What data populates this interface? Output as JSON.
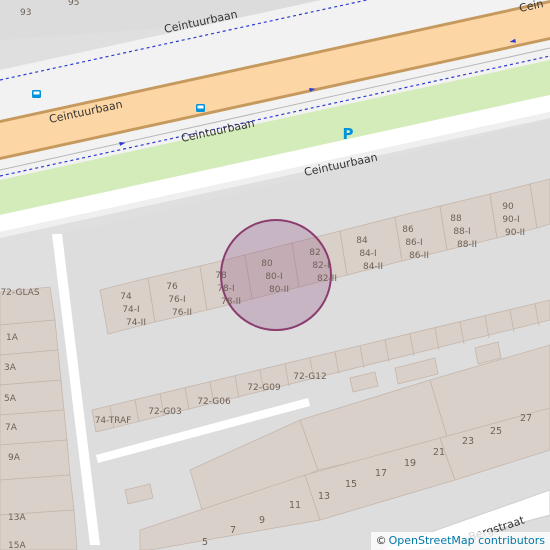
{
  "map": {
    "roads": {
      "main": "Ceintuurbaan",
      "main_top_fragment": "Cein",
      "service_road": "Ceintuurbaan",
      "parallel_road": "Ceintuurbaan",
      "side_street": "...is van der Bergstraat",
      "side_street_visible": "Bergstraat"
    },
    "parking_symbol": "P",
    "house_numbers": {
      "top": [
        "93",
        "95"
      ],
      "main_row": [
        {
          "lines": [
            "74",
            "74-I",
            "74-II"
          ]
        },
        {
          "lines": [
            "76",
            "76-I",
            "76-II"
          ]
        },
        {
          "lines": [
            "78",
            "78-I",
            "78-II"
          ]
        },
        {
          "lines": [
            "80",
            "80-I",
            "80-II"
          ]
        },
        {
          "lines": [
            "82",
            "82-I",
            "82-II"
          ]
        },
        {
          "lines": [
            "84",
            "84-I",
            "84-II"
          ]
        },
        {
          "lines": [
            "86",
            "86-I",
            "86-II"
          ]
        },
        {
          "lines": [
            "88",
            "88-I",
            "88-II"
          ]
        },
        {
          "lines": [
            "90",
            "90-I",
            "90-II"
          ]
        }
      ],
      "garages": [
        "74-TRAF",
        "72-G03",
        "72-G06",
        "72-G09",
        "72-G12"
      ],
      "left_column": [
        "72-GLAS",
        "1A",
        "3A",
        "5A",
        "7A",
        "9A",
        "13A",
        "15A"
      ],
      "bottom_row": [
        "5",
        "7",
        "9",
        "11",
        "13",
        "15",
        "17",
        "19",
        "21",
        "23",
        "25",
        "27"
      ]
    },
    "colors": {
      "background": "#e0dfdf",
      "primary_road": "#fcd6a4",
      "primary_casing": "#c69a5e",
      "footway": "#fa8072",
      "cycleway": "#0000ff",
      "grass": "#cdebb0",
      "building": "#d9d0c9",
      "building_outline": "#c4b6ab",
      "parking_blue": "#0092da",
      "highlight_fill": "rgba(134,65,120,0.25)",
      "highlight_stroke": "#8b3d70"
    }
  },
  "attribution": {
    "copyright": "©",
    "link_text": "OpenStreetMap contributors"
  }
}
